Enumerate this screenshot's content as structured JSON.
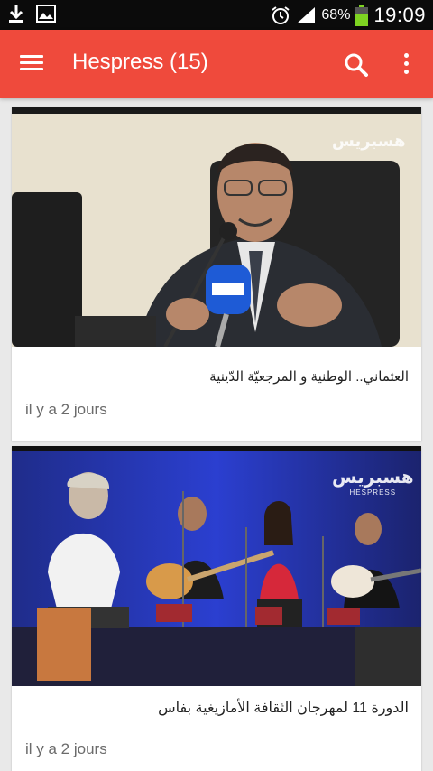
{
  "status_bar": {
    "icons": [
      "download-icon",
      "image-icon",
      "alarm-icon",
      "signal-icon",
      "battery-icon"
    ],
    "battery_percent": "68%",
    "time": "19:09"
  },
  "app_bar": {
    "title": "Hespress (15)",
    "icons": [
      "menu-icon",
      "search-icon",
      "more-vert-icon"
    ],
    "color": "#ef4a3c"
  },
  "feed": [
    {
      "title": "العثماني.. الوطنية و المرجعيّة الدّينية",
      "time": "il y a 2 jours",
      "watermark": "هسبريس"
    },
    {
      "title": "الدورة 11 لمهرجان الثقافة الأمازيغية بفاس",
      "time": "il y a 2 jours",
      "watermark": "هسبريس",
      "watermark_sub": "HESPRESS"
    }
  ]
}
